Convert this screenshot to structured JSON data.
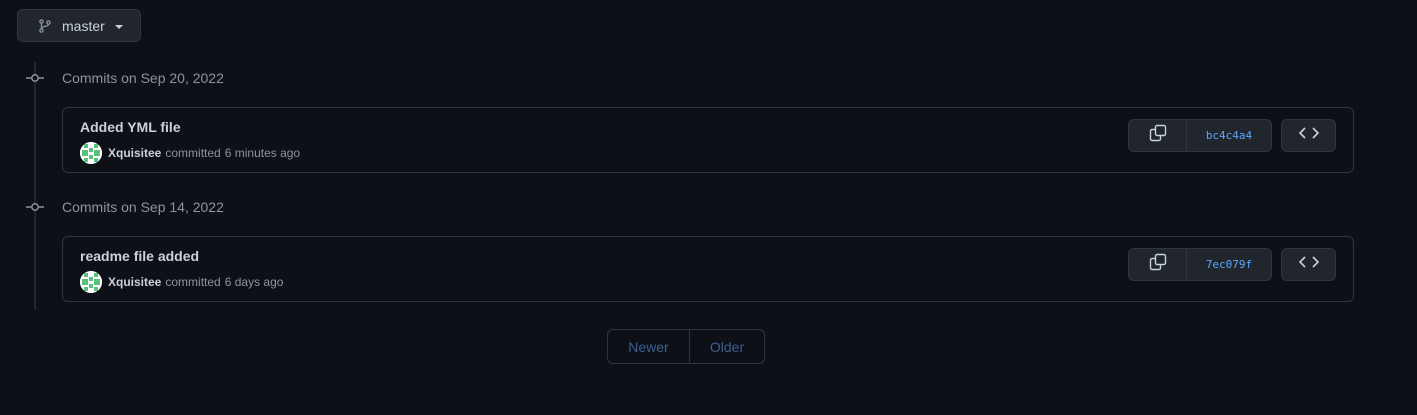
{
  "branch": {
    "name": "master",
    "icon": "git-branch-icon"
  },
  "groups": [
    {
      "date_label": "Commits on Sep 20, 2022",
      "commits": [
        {
          "title": "Added YML file",
          "author": "Xquisitee",
          "action": "committed",
          "time": "6 minutes ago",
          "sha": "bc4c4a4"
        }
      ]
    },
    {
      "date_label": "Commits on Sep 14, 2022",
      "commits": [
        {
          "title": "readme file added",
          "author": "Xquisitee",
          "action": "committed",
          "time": "6 days ago",
          "sha": "7ec079f"
        }
      ]
    }
  ],
  "pagination": {
    "newer": "Newer",
    "older": "Older"
  },
  "colors": {
    "background": "#0d1117",
    "border": "#30363d",
    "button_bg": "#21262d",
    "link": "#58a6ff",
    "muted": "#8b949e",
    "disabled_link": "#3b5f8f"
  }
}
